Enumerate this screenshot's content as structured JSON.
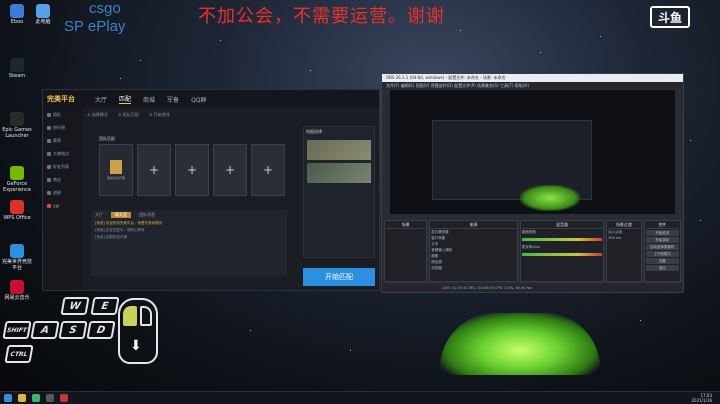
{
  "overlay": {
    "notice": "不加公会，不需要运营。谢谢",
    "tag_line1": "csgo",
    "tag_line2": "SP    ePlay",
    "platform_logo": "斗鱼"
  },
  "desktop_icons": [
    {
      "label": "Eboo",
      "color": "#3d7bd9"
    },
    {
      "label": "此电脑",
      "color": "#5aa0e8"
    },
    {
      "label": "Steam",
      "color": "#1b2838"
    },
    {
      "label": "Epic Games Launcher",
      "color": "#2a2a2a"
    },
    {
      "label": "GeForce Experience",
      "color": "#76b900"
    },
    {
      "label": "WPS Office",
      "color": "#d8322b"
    },
    {
      "label": "完美世界竞技平台",
      "color": "#2d8fe0"
    },
    {
      "label": "网易云音乐",
      "color": "#c8102e"
    }
  ],
  "client": {
    "logo": "完美平台",
    "nav": [
      "大厅",
      "匹配",
      "商城",
      "军备",
      "QQ群"
    ],
    "active_nav": "匹配",
    "sidebar": [
      "组队",
      "排行榜",
      "赛季",
      "大神指点",
      "好友列表",
      "商店",
      "战绩",
      "VIP"
    ],
    "steps": [
      "① 选择模式",
      "② 组队匹配",
      "③ 开始游戏"
    ],
    "team_title": "团队匹配",
    "first_card_text": "邀请好友开黑",
    "maps_title": "地图选择",
    "chat_tabs": [
      "大厅",
      "聊天室",
      "团队消息"
    ],
    "chat_active": "聊天室",
    "chat_lines": [
      "[系统] 欢迎来到完美平台，请遵守游戏规则",
      "[系统] 正在匹配中，请耐心等待",
      "[系统] 匹配队伍已满"
    ],
    "start_button": "开始匹配"
  },
  "obs": {
    "title": "OBS 26.1.1 (64-bit, windows) - 配置文件: 未命名 - 场景: 未命名",
    "menu": "文件(F)  编辑(E)  视图(V)  停靠部件(D)  配置文件(P)  场景集合(S)  工具(T)  帮助(H)",
    "panels": {
      "scenes": "场景",
      "sources": "来源",
      "mixer": "混音器",
      "transitions": "场景过渡",
      "controls": "控件"
    },
    "sources": [
      "显示器采集",
      "窗口采集",
      "文本",
      "音频输入捕获",
      "图像",
      "颜色源",
      "浏览器"
    ],
    "mixer_channels": [
      "桌面音频",
      "麦克风/Aux"
    ],
    "transition_value": "淡入淡出",
    "transition_duration": "300 ms",
    "controls": [
      "开始推流",
      "开始录制",
      "启动虚拟摄像机",
      "工作室模式",
      "设置",
      "退出"
    ],
    "status": "LIVE: 01:19:31   REC: 00:00:00   CPU: 3.5%, 60.00 fps"
  },
  "keys": [
    "W",
    "E",
    "A",
    "S",
    "D",
    "SHIFT",
    "CTRL"
  ],
  "taskbar": {
    "time": "17:03",
    "date": "2021/1/16"
  }
}
